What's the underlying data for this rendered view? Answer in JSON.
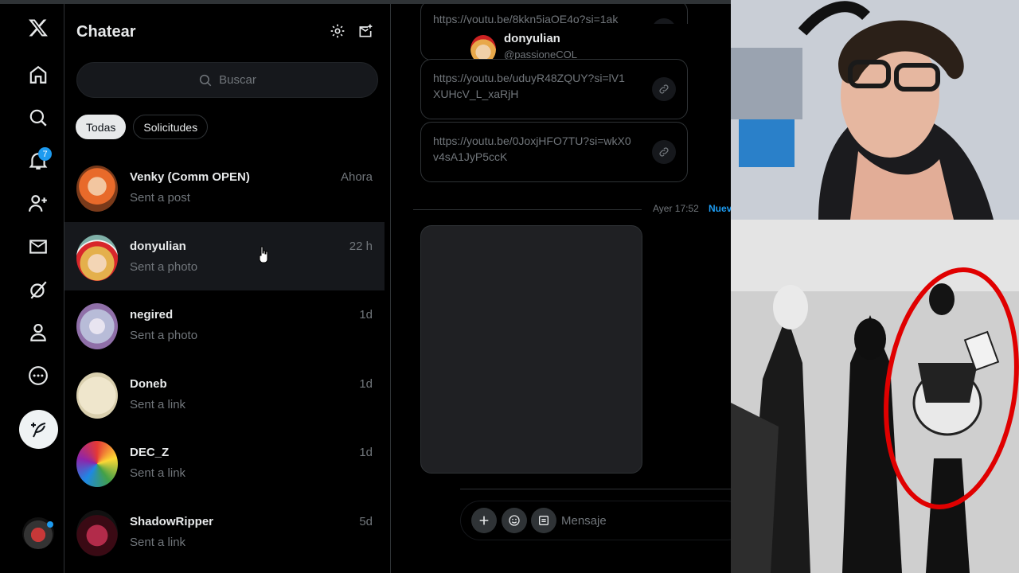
{
  "nav": {
    "notifications_count": "7",
    "items": [
      "x-logo-icon",
      "home-icon",
      "search-icon",
      "bell-icon",
      "people-icon",
      "mail-icon",
      "grok-icon",
      "profile-icon",
      "more-icon"
    ]
  },
  "chat_list": {
    "title": "Chatear",
    "search_placeholder": "Buscar",
    "tabs": [
      {
        "label": "Todas",
        "active": true
      },
      {
        "label": "Solicitudes",
        "active": false
      }
    ],
    "rows": [
      {
        "name": "Venky (Comm OPEN)",
        "time": "Ahora",
        "preview": "Sent a post"
      },
      {
        "name": "donyulian",
        "time": "22 h",
        "preview": "Sent a photo"
      },
      {
        "name": "negired",
        "time": "1d",
        "preview": "Sent a photo"
      },
      {
        "name": "Doneb",
        "time": "1d",
        "preview": "Sent a link"
      },
      {
        "name": "DEC_Z",
        "time": "1d",
        "preview": "Sent a link"
      },
      {
        "name": "ShadowRipper",
        "time": "5d",
        "preview": "Sent a link"
      }
    ]
  },
  "conversation": {
    "hover_name": "donyulian",
    "hover_handle": "@passioneCOL",
    "links": [
      "https://youtu.be/8kkn5iaOE4o?si=1ak",
      "https://youtu.be/uduyR48ZQUY?si=lV1XUHcV_L_xaRjH",
      "https://youtu.be/0JoxjHFO7TU?si=wkX0v4sA1JyP5ccK"
    ],
    "day_label": "Ayer 17:52",
    "new_label": "Nuev",
    "message_placeholder": "Mensaje"
  },
  "colors": {
    "accent": "#1d9bf0",
    "bg": "#000000",
    "muted": "#71767b",
    "text": "#e7e9ea"
  }
}
